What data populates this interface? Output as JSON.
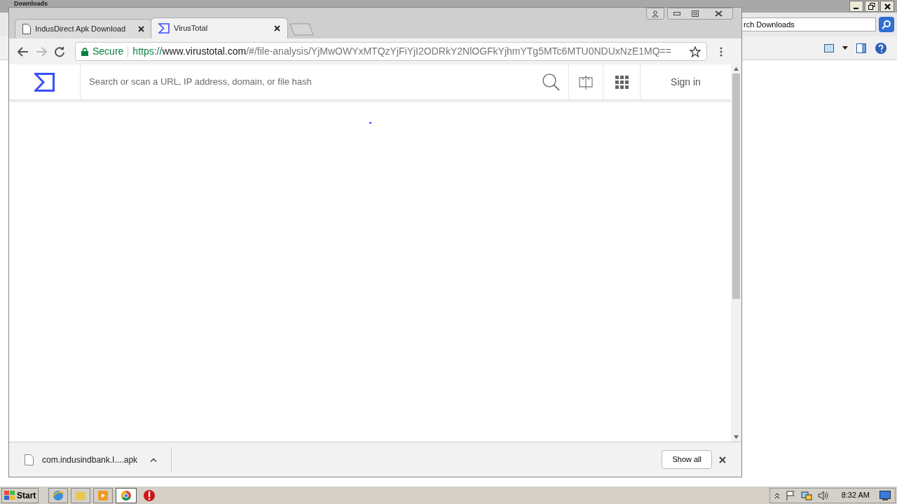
{
  "background_window": {
    "title": "Downloads",
    "search_value": "rch Downloads"
  },
  "browser": {
    "tabs": [
      {
        "title": "IndusDirect Apk Download",
        "selected": false,
        "kind": "page"
      },
      {
        "title": "VirusTotal",
        "selected": true,
        "kind": "virustotal"
      }
    ],
    "address": {
      "security": "Secure",
      "scheme": "https://",
      "host": "www.virustotal.com",
      "path": "/#/file-analysis/YjMwOWYxMTQzYjFiYjI2ODRkY2NlOGFkYjhmYTg5MTc6MTU0NDUxNzE1MQ=="
    },
    "page": {
      "search_placeholder": "Search or scan a URL, IP address, domain, or file hash",
      "sign_in": "Sign in"
    },
    "download_bar": {
      "file": "com.indusindbank.I....apk",
      "show_all": "Show all"
    }
  },
  "taskbar": {
    "start": "Start",
    "clock": "8:32 AM"
  }
}
